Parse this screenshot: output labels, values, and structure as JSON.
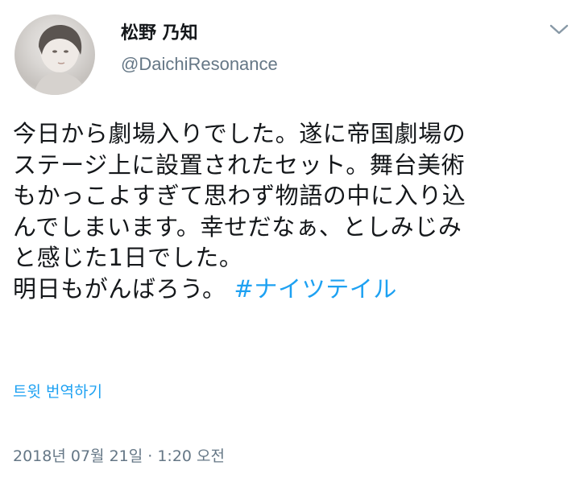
{
  "tweet": {
    "author": {
      "display_name": "松野 乃知",
      "handle": "@DaichiResonance",
      "avatar_icon": "avatar-photo"
    },
    "menu_icon": "chevron-down-icon",
    "text_lines": [
      "今日から劇場入りでした。遂に帝国劇場の",
      "ステージ上に設置されたセット。舞台美術",
      "もかっこよすぎて思わず物語の中に入り込",
      "んでしまいます。幸せだなぁ、としみじみ",
      "と感じた1日でした。"
    ],
    "last_line_text": "明日もがんばろう。",
    "hashtag": "#ナイツテイル",
    "translate_label": "트윗 번역하기",
    "timestamp": "2018년 07월 21일 · 1:20 오전"
  },
  "colors": {
    "text": "#14171a",
    "secondary": "#657786",
    "accent": "#1da1f2"
  }
}
